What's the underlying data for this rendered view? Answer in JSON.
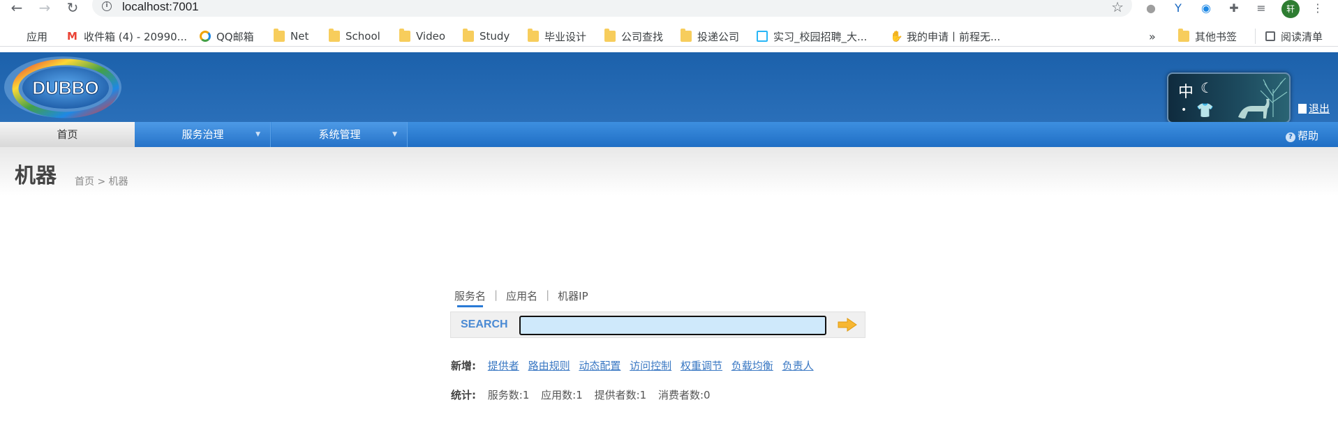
{
  "browser": {
    "url": "localhost:7001",
    "bookmarks": [
      {
        "label": "应用",
        "icon": "apps-grid-icon"
      },
      {
        "label": "收件箱 (4) - 20990...",
        "icon": "gmail-icon"
      },
      {
        "label": "QQ邮箱",
        "icon": "qq-mail-icon"
      },
      {
        "label": "Net",
        "icon": "folder-icon"
      },
      {
        "label": "School",
        "icon": "folder-icon"
      },
      {
        "label": "Video",
        "icon": "folder-icon"
      },
      {
        "label": "Study",
        "icon": "folder-icon"
      },
      {
        "label": "毕业设计",
        "icon": "folder-icon"
      },
      {
        "label": "公司查找",
        "icon": "folder-icon"
      },
      {
        "label": "投递公司",
        "icon": "folder-icon"
      },
      {
        "label": "实习_校园招聘_大...",
        "icon": "job-site-icon"
      },
      {
        "label": "我的申请丨前程无...",
        "icon": "hand-icon"
      }
    ],
    "more_bookmarks": "»",
    "other_bookmarks": "其他书签",
    "reading_list": "阅读清单",
    "avatar_initial": "轩"
  },
  "header": {
    "logo_text": "DUBBO",
    "skin_zh": "中",
    "logout": "退出"
  },
  "menu": {
    "home": "首页",
    "service_governance": "服务治理",
    "system_management": "系统管理",
    "help": "帮助"
  },
  "page": {
    "title": "机器",
    "breadcrumb": "首页 > 机器"
  },
  "search": {
    "tabs": [
      "服务名",
      "应用名",
      "机器IP"
    ],
    "active_tab": "服务名",
    "label": "SEARCH",
    "value": ""
  },
  "add": {
    "label": "新增:",
    "links": [
      "提供者",
      "路由规则",
      "动态配置",
      "访问控制",
      "权重调节",
      "负载均衡",
      "负责人"
    ]
  },
  "stats": {
    "label": "统计:",
    "items": [
      "服务数:1",
      "应用数:1",
      "提供者数:1",
      "消费者数:0"
    ]
  },
  "colors": {
    "header_blue": "#1c61ab",
    "menu_blue": "#2572c8",
    "link_blue": "#3a78c3",
    "search_input_bg": "#cfe9fb"
  }
}
